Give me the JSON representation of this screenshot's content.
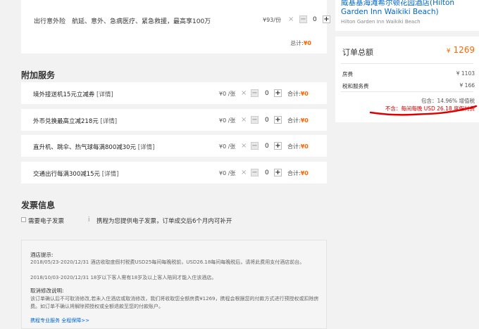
{
  "insurance": {
    "name": "出行意外险",
    "desc": "航延、意外、急病医疗、紧急救援，最高享100万",
    "price": "¥93/份",
    "times": "×",
    "minus": "−",
    "qty": "0",
    "plus": "+",
    "total_label": "总计:",
    "total_value": "¥0"
  },
  "addon": {
    "section_title": "附加服务",
    "items": [
      {
        "name": "境外接送机15元立减券",
        "link": "[详情]",
        "price": "¥0 /张",
        "times": "×",
        "minus": "−",
        "qty": "0",
        "plus": "+",
        "total_label": "合计:",
        "total_value": "¥0"
      },
      {
        "name": "外币兑换最高立减218元",
        "link": "[详情]",
        "price": "¥0 /张",
        "times": "×",
        "minus": "−",
        "qty": "0",
        "plus": "+",
        "total_label": "合计:",
        "total_value": "¥0"
      },
      {
        "name": "直升机、跳伞、热气球每满800减30元",
        "link": "[详情]",
        "price": "¥0 /张",
        "times": "×",
        "minus": "−",
        "qty": "0",
        "plus": "+",
        "total_label": "合计:",
        "total_value": "¥0"
      },
      {
        "name": "交通出行每满300减15元",
        "link": "[详情]",
        "price": "¥0 /张",
        "times": "×",
        "minus": "−",
        "qty": "0",
        "plus": "+",
        "total_label": "合计:",
        "total_value": "¥0"
      }
    ]
  },
  "invoice": {
    "section_title": "发票信息",
    "checkbox_label": "需要电子发票",
    "icon": "i",
    "note": "携程为您提供电子发票，订单成交后6个月内可补开"
  },
  "notice": {
    "hotel_title": "酒店提示:",
    "hotel_line1": "2018/05/23-2020/12/31 酒店收取度假村税费USD25每间每晚税前，USD26.18每间每晚税后，请将此费用支付酒店前台。",
    "hotel_line2": "2018/10/03-2020/12/31 18岁以下客人需有18岁及以上客人陪同才能入住该酒店。",
    "cancel_title": "取消修改说明:",
    "cancel_text": "该订单确认后不可取消修改,若未入住酒店或取消修改，我们将收取您全额房费¥1269，携程会根据您的付款方式进行预授权或扣除房费。如订单不确认将解除预授权或全额退款至您的付款账户。",
    "link": "携程专业服务 全程保障>>"
  },
  "hotel": {
    "name": "威基基海滩希尔顿花园酒店(Hilton Garden Inn Waikiki Beach)",
    "name_en": "Hilton Garden Inn Waikiki Beach"
  },
  "summary": {
    "title": "订单总额",
    "currency": "¥",
    "total": "1269",
    "room_label": "房费",
    "room_value": "¥ 1103",
    "tax_label": "税和服务费",
    "tax_value": "¥ 166",
    "tax_info": "包含：14.96% 增值税",
    "excluded": "不含：每间每晚 USD 26.18 度假村费"
  },
  "colors": {
    "accent": "#ff6600",
    "link": "#0066cc",
    "annotation": "#dd0000"
  }
}
